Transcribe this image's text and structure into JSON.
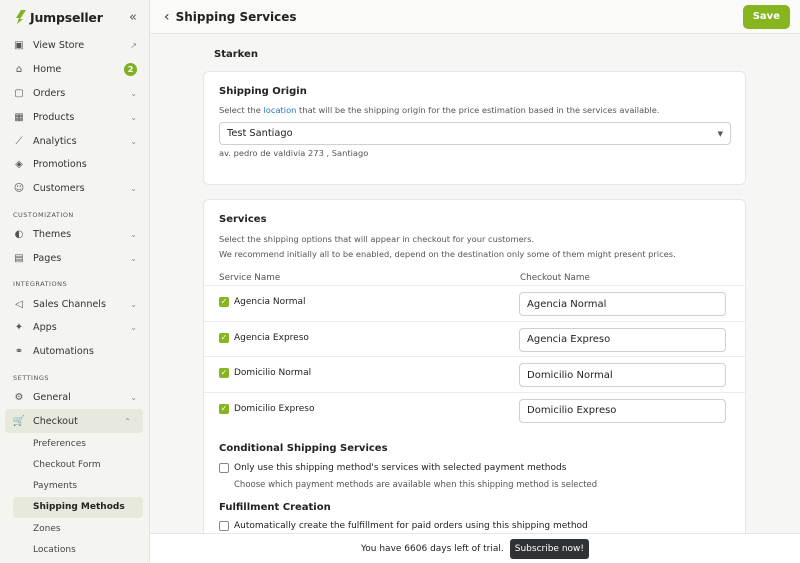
{
  "app": {
    "name": "Jumpseller",
    "collapse_icon": "«"
  },
  "colors": {
    "accent": "#86b51e",
    "link": "#2a72c9",
    "dark_button": "#2f3336"
  },
  "sidebar": {
    "items": [
      {
        "label": "View Store",
        "icon": "store-icon",
        "trailing": "↗"
      },
      {
        "label": "Home",
        "icon": "home-icon",
        "badge": "2"
      },
      {
        "label": "Orders",
        "icon": "orders-icon",
        "trailing": "⌄"
      },
      {
        "label": "Products",
        "icon": "products-icon",
        "trailing": "⌄"
      },
      {
        "label": "Analytics",
        "icon": "analytics-icon",
        "trailing": "⌄"
      },
      {
        "label": "Promotions",
        "icon": "tag-icon"
      },
      {
        "label": "Customers",
        "icon": "customers-icon",
        "trailing": "⌄"
      }
    ],
    "customization_label": "CUSTOMIZATION",
    "customization_items": [
      {
        "label": "Themes",
        "icon": "palette-icon",
        "trailing": "⌄"
      },
      {
        "label": "Pages",
        "icon": "pages-icon",
        "trailing": "⌄"
      }
    ],
    "integrations_label": "INTEGRATIONS",
    "integrations_items": [
      {
        "label": "Sales Channels",
        "icon": "megaphone-icon",
        "trailing": "⌄"
      },
      {
        "label": "Apps",
        "icon": "apps-icon",
        "trailing": "⌄"
      },
      {
        "label": "Automations",
        "icon": "automations-icon"
      }
    ],
    "settings_label": "SETTINGS",
    "settings_items": [
      {
        "label": "General",
        "icon": "gear-icon",
        "trailing": "⌄"
      },
      {
        "label": "Checkout",
        "icon": "cart-icon",
        "trailing": "⌃"
      }
    ],
    "checkout_sub": [
      "Preferences",
      "Checkout Form",
      "Payments",
      "Shipping Methods",
      "Zones",
      "Locations"
    ]
  },
  "header": {
    "back": "‹",
    "title": "Shipping Services",
    "save_label": "Save"
  },
  "main": {
    "carrier": "Starken",
    "origin": {
      "title": "Shipping Origin",
      "desc_pre": "Select the ",
      "desc_link": "location",
      "desc_post": " that will be the shipping origin for the price estimation based in the services available.",
      "selected": "Test Santiago",
      "address": "av. pedro de valdivia 273 , Santiago"
    },
    "services": {
      "title": "Services",
      "desc1": "Select the shipping options that will appear in checkout for your customers.",
      "desc2": "We recommend initially all to be enabled, depend on the destination only some of them might present prices.",
      "col_service": "Service Name",
      "col_checkout": "Checkout Name",
      "rows": [
        {
          "service": "Agencia Normal",
          "checkout": "Agencia Normal"
        },
        {
          "service": "Agencia Expreso",
          "checkout": "Agencia Expreso"
        },
        {
          "service": "Domicilio Normal",
          "checkout": "Domicilio Normal"
        },
        {
          "service": "Domicilio Expreso",
          "checkout": "Domicilio Expreso"
        }
      ],
      "conditional_title": "Conditional Shipping Services",
      "conditional_label": "Only use this shipping method's services with selected payment methods",
      "conditional_help": "Choose which payment methods are available when this shipping method is selected",
      "fulfillment_title": "Fulfillment Creation",
      "fulfillment_label": "Automatically create the fulfillment for paid orders using this shipping method"
    }
  },
  "trial": {
    "text": "You have 6606 days left of trial.",
    "button": "Subscribe now!"
  }
}
